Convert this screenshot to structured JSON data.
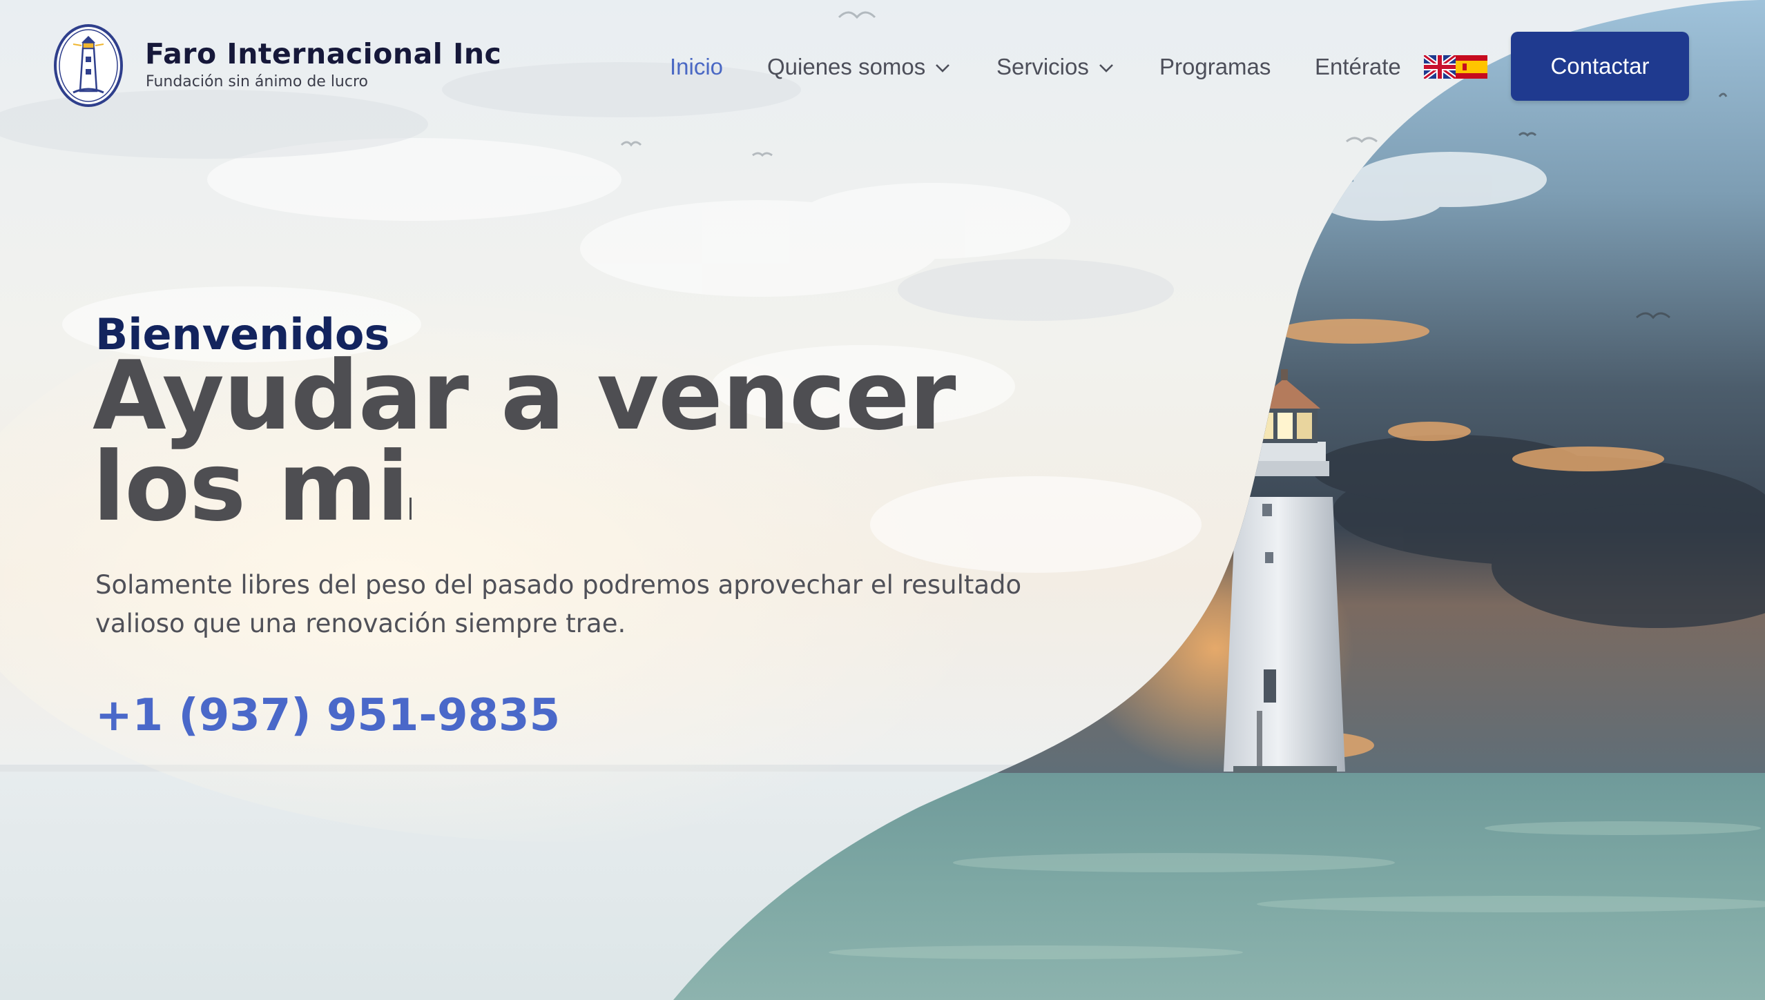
{
  "brand": {
    "name": "Faro Internacional Inc",
    "tagline": "Fundación sin ánimo de lucro"
  },
  "nav": {
    "items": [
      {
        "label": "Inicio",
        "active": true,
        "has_dropdown": false
      },
      {
        "label": "Quienes somos",
        "active": false,
        "has_dropdown": true
      },
      {
        "label": "Servicios",
        "active": false,
        "has_dropdown": true
      },
      {
        "label": "Programas",
        "active": false,
        "has_dropdown": false
      },
      {
        "label": "Entérate",
        "active": false,
        "has_dropdown": false
      }
    ],
    "languages": [
      {
        "code": "en",
        "icon": "uk-flag-icon"
      },
      {
        "code": "es",
        "icon": "spain-flag-icon"
      }
    ],
    "cta_label": "Contactar"
  },
  "hero": {
    "welcome": "Bienvenidos",
    "headline_typed": "Ayudar a vencer los mi",
    "subtext": "Solamente libres del peso del pasado podremos aprovechar el resultado valioso que una renovación siempre trae.",
    "phone": "+1 (937) 951-9835"
  },
  "colors": {
    "accent_blue": "#4a68c4",
    "cta_bg": "#1f3a8f",
    "welcome_text": "#13245e",
    "headline_text": "#4e4e52"
  }
}
